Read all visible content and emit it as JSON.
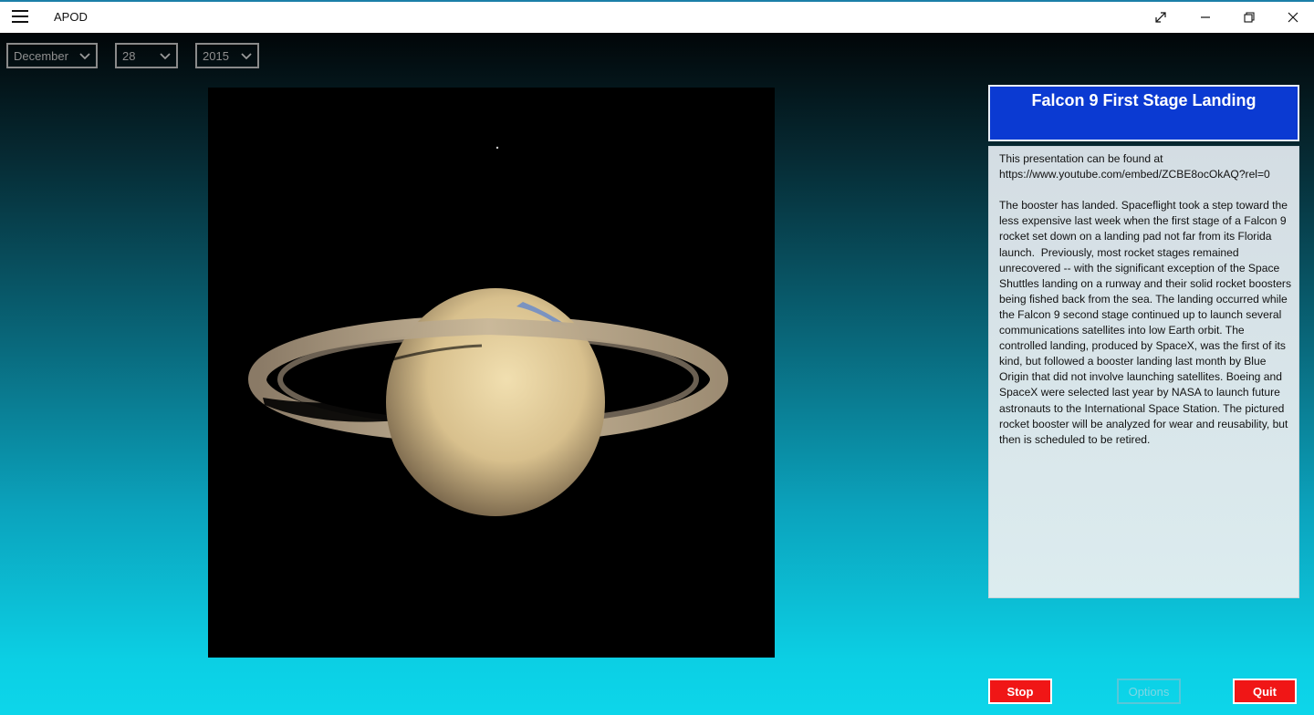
{
  "app": {
    "title": "APOD"
  },
  "window_controls": {
    "icons": [
      "fullscreen-icon",
      "minimize-icon",
      "restore-icon",
      "close-icon"
    ]
  },
  "date": {
    "month": "December",
    "day": "28",
    "year": "2015"
  },
  "apod": {
    "title": "Falcon 9 First Stage Landing",
    "explanation": "This presentation can be found at\nhttps://www.youtube.com/embed/ZCBE8ocOkAQ?rel=0\n\nThe booster has landed. Spaceflight took a step toward the less expensive last week when the first stage of a Falcon 9 rocket set down on a landing pad not far from its Florida launch.  Previously, most rocket stages remained unrecovered -- with the significant exception of the Space Shuttles landing on a runway and their solid rocket boosters being fished back from the sea. The landing occurred while the Falcon 9 second stage continued up to launch several communications satellites into low Earth orbit. The controlled landing, produced by SpaceX, was the first of its kind, but followed a booster landing last month by Blue Origin that did not involve launching satellites. Boeing and SpaceX were selected last year by NASA to launch future astronauts to the International Space Station. The pictured rocket booster will be analyzed for wear and reusability, but then is scheduled to be retired."
  },
  "buttons": {
    "stop": "Stop",
    "options": "Options",
    "quit": "Quit"
  },
  "colors": {
    "title_bg": "#0b3ad2",
    "stop_bg": "#f01616",
    "quit_bg": "#f01616",
    "gradient_bottom": "#0dd6ea"
  }
}
